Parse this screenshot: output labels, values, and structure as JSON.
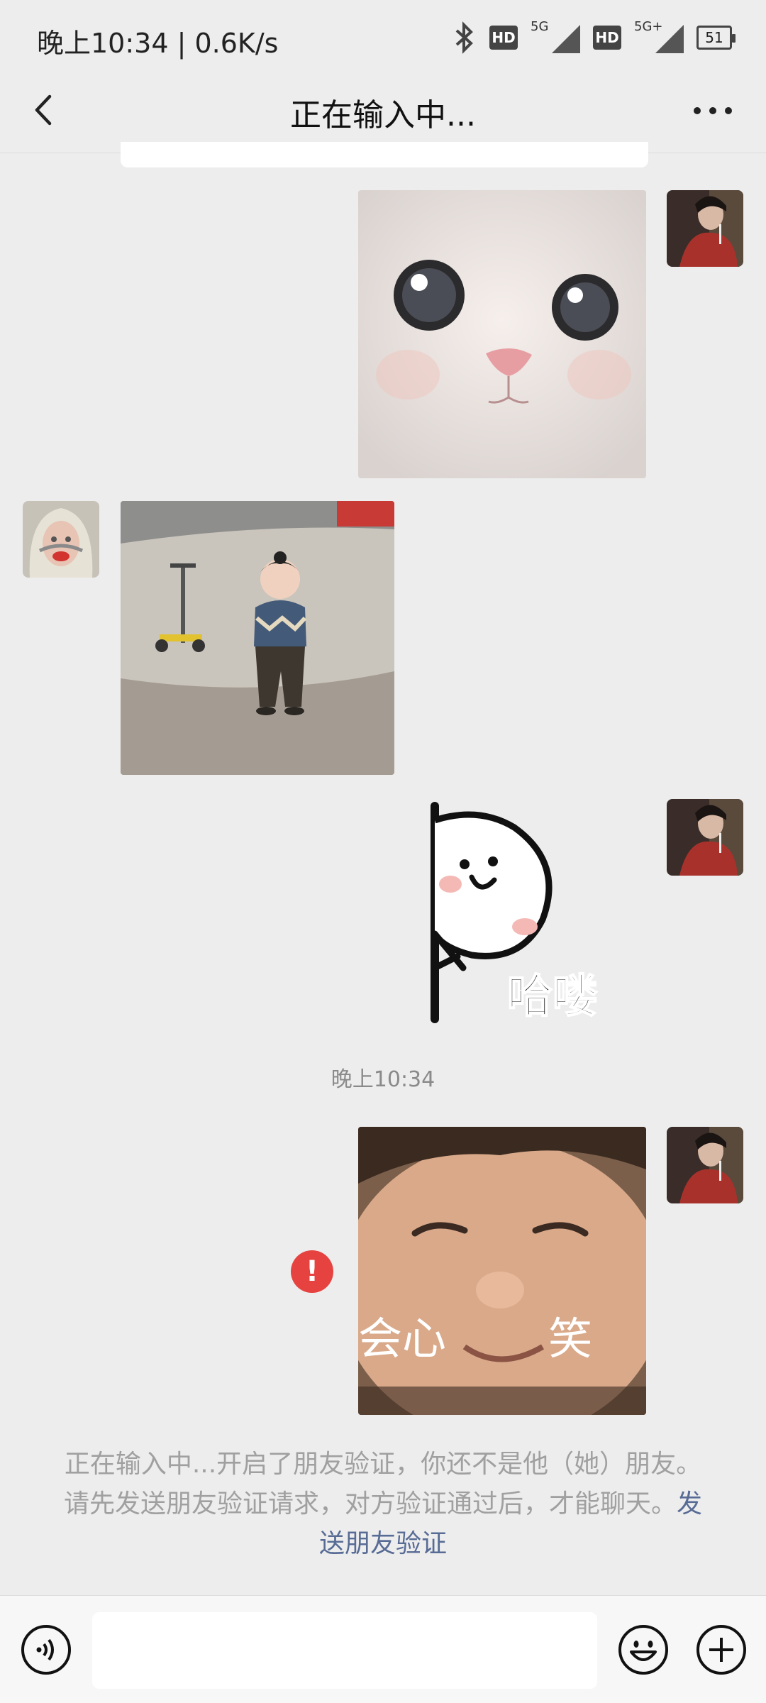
{
  "status_bar": {
    "time_speed": "晚上10:34 | 0.6K/s",
    "sim1": {
      "hd": "HD",
      "network": "5G"
    },
    "sim2": {
      "hd": "HD",
      "network": "5G+"
    },
    "battery": "51"
  },
  "nav": {
    "title": "正在输入中..."
  },
  "messages": [
    {
      "side": "right",
      "type": "sticker",
      "content": "cat-face-sticker"
    },
    {
      "side": "left",
      "type": "sticker",
      "content": "toddler-walking-sticker"
    },
    {
      "side": "right",
      "type": "sticker",
      "content": "peeking-face-sticker",
      "text": "哈喽"
    },
    {
      "type": "timestamp",
      "text": "晚上10:34"
    },
    {
      "side": "right",
      "type": "sticker",
      "content": "baby-smile-sticker",
      "caption_left": "会心",
      "caption_right": "笑",
      "status": "send-failed"
    }
  ],
  "notice": {
    "text": "正在输入中...开启了朋友验证，你还不是他（她）朋友。请先发送朋友验证请求，对方验证通过后，才能聊天。",
    "link": "发送朋友验证"
  },
  "bottom_bar": {
    "icons": [
      "voice-icon",
      "emoji-icon",
      "plus-icon"
    ],
    "input_value": ""
  },
  "colors": {
    "background": "#ededed",
    "error": "#e64340",
    "link": "#576b95"
  }
}
